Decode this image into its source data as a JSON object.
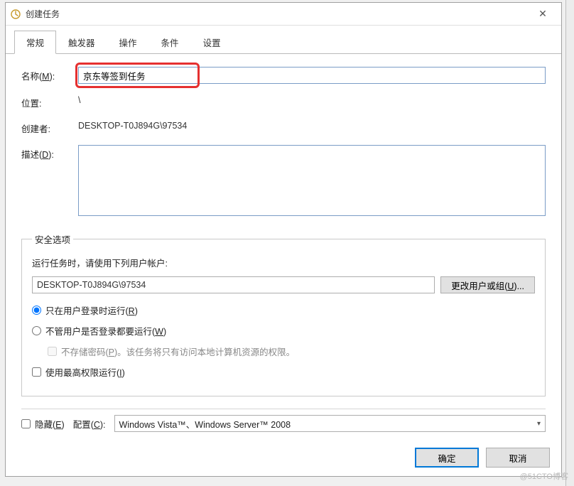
{
  "window": {
    "title": "创建任务",
    "close_glyph": "✕"
  },
  "tabs": {
    "general": "常规",
    "triggers": "触发器",
    "actions": "操作",
    "conditions": "条件",
    "settings": "设置"
  },
  "form": {
    "name_label_pre": "名称(",
    "name_label_u": "M",
    "name_label_post": "):",
    "name_value": "京东等签到任务",
    "location_label": "位置:",
    "location_value": "\\",
    "author_label": "创建者:",
    "author_value": "DESKTOP-T0J894G\\97534",
    "desc_label_pre": "描述(",
    "desc_label_u": "D",
    "desc_label_post": "):",
    "desc_value": ""
  },
  "security": {
    "legend": "安全选项",
    "prompt": "运行任务时，请使用下列用户帐户:",
    "account": "DESKTOP-T0J894G\\97534",
    "change_btn_pre": "更改用户或组(",
    "change_btn_u": "U",
    "change_btn_post": ")...",
    "radio_loggedon_pre": "只在用户登录时运行(",
    "radio_loggedon_u": "R",
    "radio_loggedon_post": ")",
    "radio_always_pre": "不管用户是否登录都要运行(",
    "radio_always_u": "W",
    "radio_always_post": ")",
    "nostore_pre": "不存储密码(",
    "nostore_u": "P",
    "nostore_post": ")。该任务将只有访问本地计算机资源的权限。",
    "highest_pre": "使用最高权限运行(",
    "highest_u": "I",
    "highest_post": ")"
  },
  "bottom": {
    "hidden_pre": "隐藏(",
    "hidden_u": "E",
    "hidden_post": ")",
    "config_label_pre": "配置(",
    "config_label_u": "C",
    "config_label_post": "):",
    "config_value": "Windows Vista™、Windows Server™ 2008"
  },
  "buttons": {
    "ok": "确定",
    "cancel": "取消"
  },
  "watermark": "@51CTO博客"
}
